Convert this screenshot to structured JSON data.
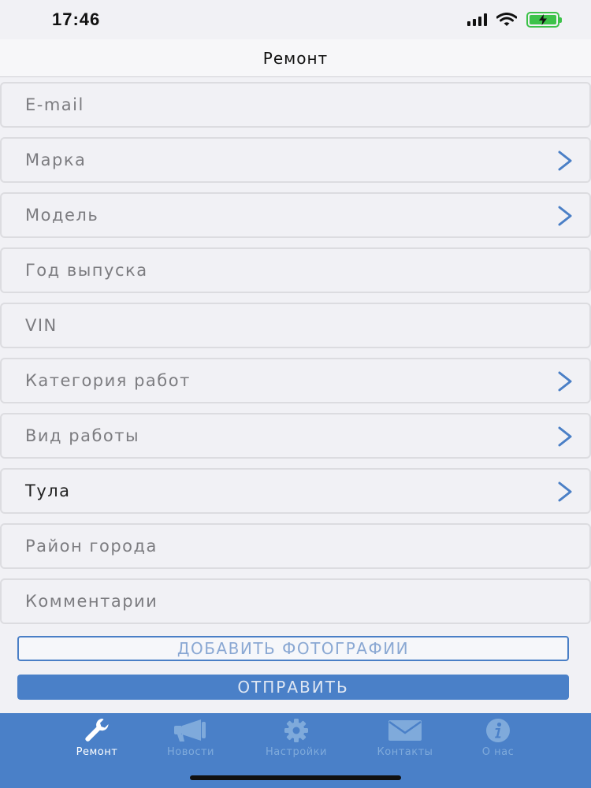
{
  "status_bar": {
    "time": "17:46"
  },
  "nav": {
    "title": "Ремонт"
  },
  "form": {
    "rows": [
      {
        "label": "E-mail",
        "chevron": false,
        "filled": false
      },
      {
        "label": "Марка",
        "chevron": true,
        "filled": false
      },
      {
        "label": "Модель",
        "chevron": true,
        "filled": false
      },
      {
        "label": "Год выпуска",
        "chevron": false,
        "filled": false
      },
      {
        "label": "VIN",
        "chevron": false,
        "filled": false
      },
      {
        "label": "Категория работ",
        "chevron": true,
        "filled": false
      },
      {
        "label": "Вид работы",
        "chevron": true,
        "filled": false
      },
      {
        "label": "Тула",
        "chevron": true,
        "filled": true
      },
      {
        "label": "Район города",
        "chevron": false,
        "filled": false
      },
      {
        "label": "Комментарии",
        "chevron": false,
        "filled": false
      }
    ]
  },
  "buttons": {
    "add_photos": "ДОБАВИТЬ ФОТОГРАФИИ",
    "send": "ОТПРАВИТЬ"
  },
  "tab_bar": {
    "tabs": [
      {
        "label": "Ремонт",
        "icon": "wrench-icon",
        "active": true
      },
      {
        "label": "Новости",
        "icon": "megaphone-icon",
        "active": false
      },
      {
        "label": "Настройки",
        "icon": "gear-icon",
        "active": false
      },
      {
        "label": "Контакты",
        "icon": "envelope-icon",
        "active": false
      },
      {
        "label": "О нас",
        "icon": "info-icon",
        "active": false
      }
    ]
  },
  "colors": {
    "accent": "#4a80c8",
    "chevron": "#4a7fc6",
    "background": "#f1f1f5",
    "tab_inactive": "#7faadb"
  }
}
